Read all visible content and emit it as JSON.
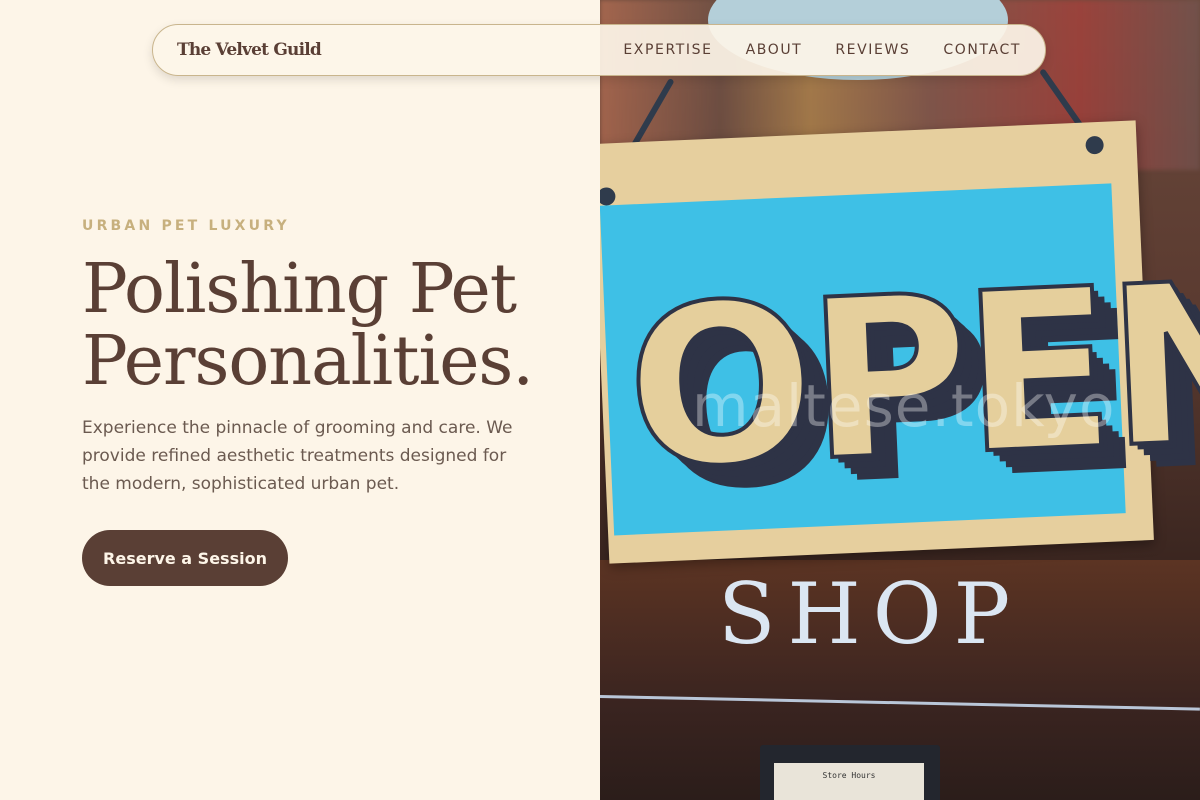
{
  "nav": {
    "brand": "The Velvet Guild",
    "links": [
      "EXPERTISE",
      "ABOUT",
      "REVIEWS",
      "CONTACT"
    ]
  },
  "hero": {
    "eyebrow": "URBAN PET LUXURY",
    "headline_line1": "Polishing Pet",
    "headline_line2": "Personalities.",
    "lead": "Experience the pinnacle of grooming and care. We provide refined aesthetic treatments designed for the modern, sophisticated urban pet.",
    "cta_label": "Reserve a Session"
  },
  "photo": {
    "sign_text": "OPEN",
    "shop_text": "SHOP",
    "watermark": "maltese.tokyo",
    "hours_card": "Store Hours"
  },
  "colors": {
    "background": "#fdf5e8",
    "primary_brown": "#5a3f35",
    "accent_gold": "#c7b07e",
    "sign_blue": "#3ec0e6"
  }
}
